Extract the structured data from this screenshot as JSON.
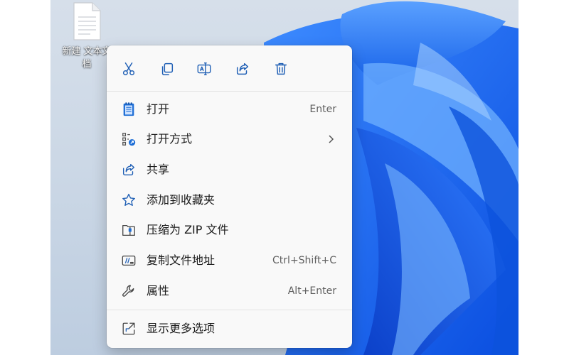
{
  "desktop": {
    "file_icon": {
      "icon": "blank-document-icon",
      "label": "新建 文本文档"
    }
  },
  "context_menu": {
    "quick_actions": [
      {
        "name": "cut",
        "icon": "scissors-icon"
      },
      {
        "name": "copy",
        "icon": "copy-icon"
      },
      {
        "name": "rename",
        "icon": "rename-icon"
      },
      {
        "name": "share",
        "icon": "share-icon"
      },
      {
        "name": "delete",
        "icon": "trash-icon"
      }
    ],
    "items": [
      {
        "label": "打开",
        "shortcut": "Enter",
        "icon": "notepad-icon"
      },
      {
        "label": "打开方式",
        "shortcut": "",
        "icon": "open-with-icon",
        "submenu": true
      },
      {
        "label": "共享",
        "shortcut": "",
        "icon": "share-icon"
      },
      {
        "label": "添加到收藏夹",
        "shortcut": "",
        "icon": "star-icon"
      },
      {
        "label": "压缩为 ZIP 文件",
        "shortcut": "",
        "icon": "zip-folder-icon"
      },
      {
        "label": "复制文件地址",
        "shortcut": "Ctrl+Shift+C",
        "icon": "copy-path-icon"
      },
      {
        "label": "属性",
        "shortcut": "Alt+Enter",
        "icon": "wrench-icon"
      }
    ],
    "more_options": {
      "label": "显示更多选项",
      "icon": "more-options-icon"
    }
  },
  "colors": {
    "accent": "#1a5fb4",
    "menu_background": "#f9f9f9",
    "wallpaper_blue": "#1f6cf0"
  }
}
